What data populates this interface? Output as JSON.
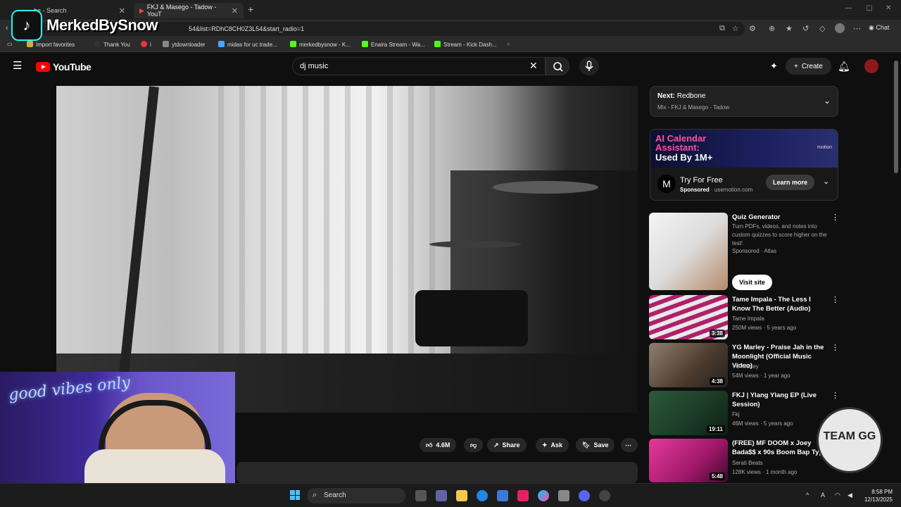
{
  "browser": {
    "tabs": [
      {
        "label": "be - Search"
      },
      {
        "label": "FKJ & Masego - Tadow - YouT"
      }
    ],
    "url": "54&list=RDhC8CH0Z3L54&start_radio=1",
    "chat_label": "Chat",
    "favorites": [
      {
        "label": "Import favorites",
        "color": "#d5a84a"
      },
      {
        "label": "Thank You",
        "color": "#333"
      },
      {
        "label": "i",
        "color": "#e53935"
      },
      {
        "label": "ytdownloader",
        "color": "#888"
      },
      {
        "label": "midas for uc trade...",
        "color": "#4aa3ff"
      },
      {
        "label": "merkedbysnow - K...",
        "color": "#53fc18"
      },
      {
        "label": "Enaira Stream - Wa...",
        "color": "#53fc18"
      },
      {
        "label": "Stream - Kick Dash...",
        "color": "#53fc18"
      }
    ]
  },
  "overlay": {
    "tiktok_name": "MerkedBySnow",
    "webcam_sign": "good vibes only",
    "badge": "TEAM GG"
  },
  "youtube": {
    "logo_text": "YouTube",
    "search_value": "dj music",
    "create_label": "Create",
    "actions": {
      "likes": "4.6M",
      "share": "Share",
      "ask": "Ask",
      "save": "Save"
    },
    "next": {
      "label": "Next:",
      "title": "Redbone",
      "subtitle": "Mix - FKJ & Masego - Tadow"
    },
    "ad": {
      "banner_line1": "AI Calendar Assistant:",
      "banner_line2": "Used By 1M+",
      "brand": "motion",
      "title": "Try For Free",
      "sponsored": "Sponsored",
      "domain": "· usemotion.com",
      "cta": "Learn more"
    },
    "sidebar": [
      {
        "title": "Quiz Generator",
        "desc": "Turn PDFs, videos, and notes into custom quizzes to score higher on the test!",
        "channel": "Sponsored · Atlas",
        "cta": "Visit site"
      },
      {
        "title": "Tame Impala - The Less I Know The Better (Audio)",
        "channel": "Tame Impala",
        "meta": "250M views · 5 years ago",
        "duration": "3:38"
      },
      {
        "title": "YG Marley - Praise Jah in the Moonlight (Official Music Video)",
        "channel": "YG Marley",
        "meta": "54M views · 1 year ago",
        "duration": "4:38"
      },
      {
        "title": "FKJ | Ylang Ylang EP (Live Session)",
        "channel": "Fkj",
        "meta": "46M views · 5 years ago",
        "duration": "19:11"
      },
      {
        "title": "(FREE) MF DOOM x Joey Bada$$ x 90s Boom Bap Type",
        "channel": "Serati Beats",
        "meta": "128K views · 1 month ago",
        "duration": "5:48"
      }
    ]
  },
  "taskbar": {
    "search_label": "Search",
    "time": "8:58 PM",
    "date": "12/13/2025"
  }
}
